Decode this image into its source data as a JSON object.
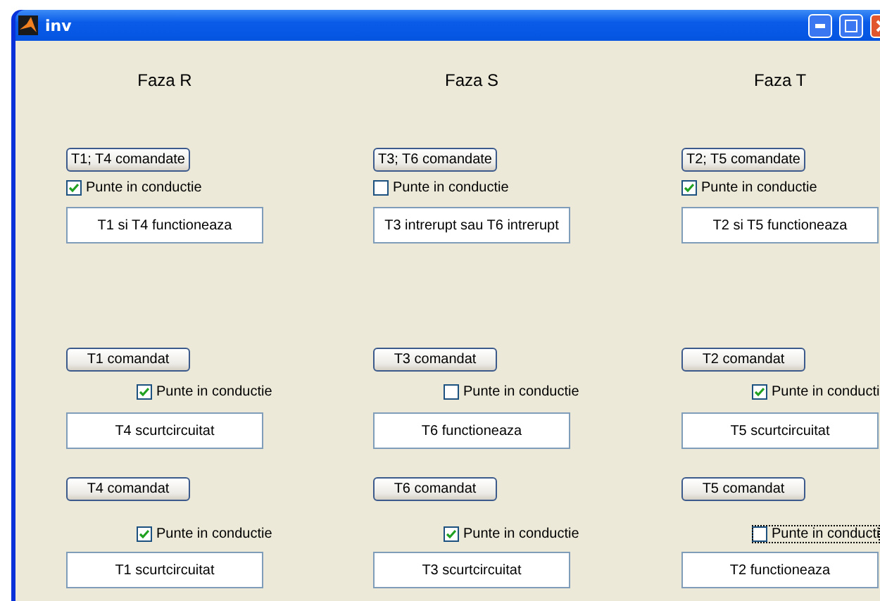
{
  "window": {
    "title": "inv"
  },
  "phases": [
    {
      "title": "Faza R",
      "groups": [
        {
          "button": "T1; T4 comandate",
          "checkbox": {
            "label": "Punte in conductie",
            "checked": true,
            "focused": false
          },
          "status": "T1 si T4 functioneaza"
        },
        {
          "button": "T1 comandat",
          "checkbox": {
            "label": "Punte in conductie",
            "checked": true,
            "focused": false
          },
          "status": "T4 scurtcircuitat"
        },
        {
          "button": "T4 comandat",
          "checkbox": {
            "label": "Punte in conductie",
            "checked": true,
            "focused": false
          },
          "status": "T1 scurtcircuitat"
        }
      ]
    },
    {
      "title": "Faza S",
      "groups": [
        {
          "button": "T3; T6 comandate",
          "checkbox": {
            "label": "Punte in conductie",
            "checked": false,
            "focused": false
          },
          "status": "T3 intrerupt sau T6 intrerupt"
        },
        {
          "button": "T3 comandat",
          "checkbox": {
            "label": "Punte in conductie",
            "checked": false,
            "focused": false
          },
          "status": "T6 functioneaza"
        },
        {
          "button": "T6 comandat",
          "checkbox": {
            "label": "Punte in conductie",
            "checked": true,
            "focused": false
          },
          "status": "T3 scurtcircuitat"
        }
      ]
    },
    {
      "title": "Faza T",
      "groups": [
        {
          "button": "T2; T5 comandate",
          "checkbox": {
            "label": "Punte in conductie",
            "checked": true,
            "focused": false
          },
          "status": "T2 si T5 functioneaza"
        },
        {
          "button": "T2 comandat",
          "checkbox": {
            "label": "Punte in conducti",
            "checked": true,
            "focused": false
          },
          "status": "T5 scurtcircuitat"
        },
        {
          "button": "T5 comandat",
          "checkbox": {
            "label": "Punte in conducti",
            "checked": false,
            "focused": true
          },
          "status": "T2 functioneaza"
        }
      ]
    }
  ]
}
